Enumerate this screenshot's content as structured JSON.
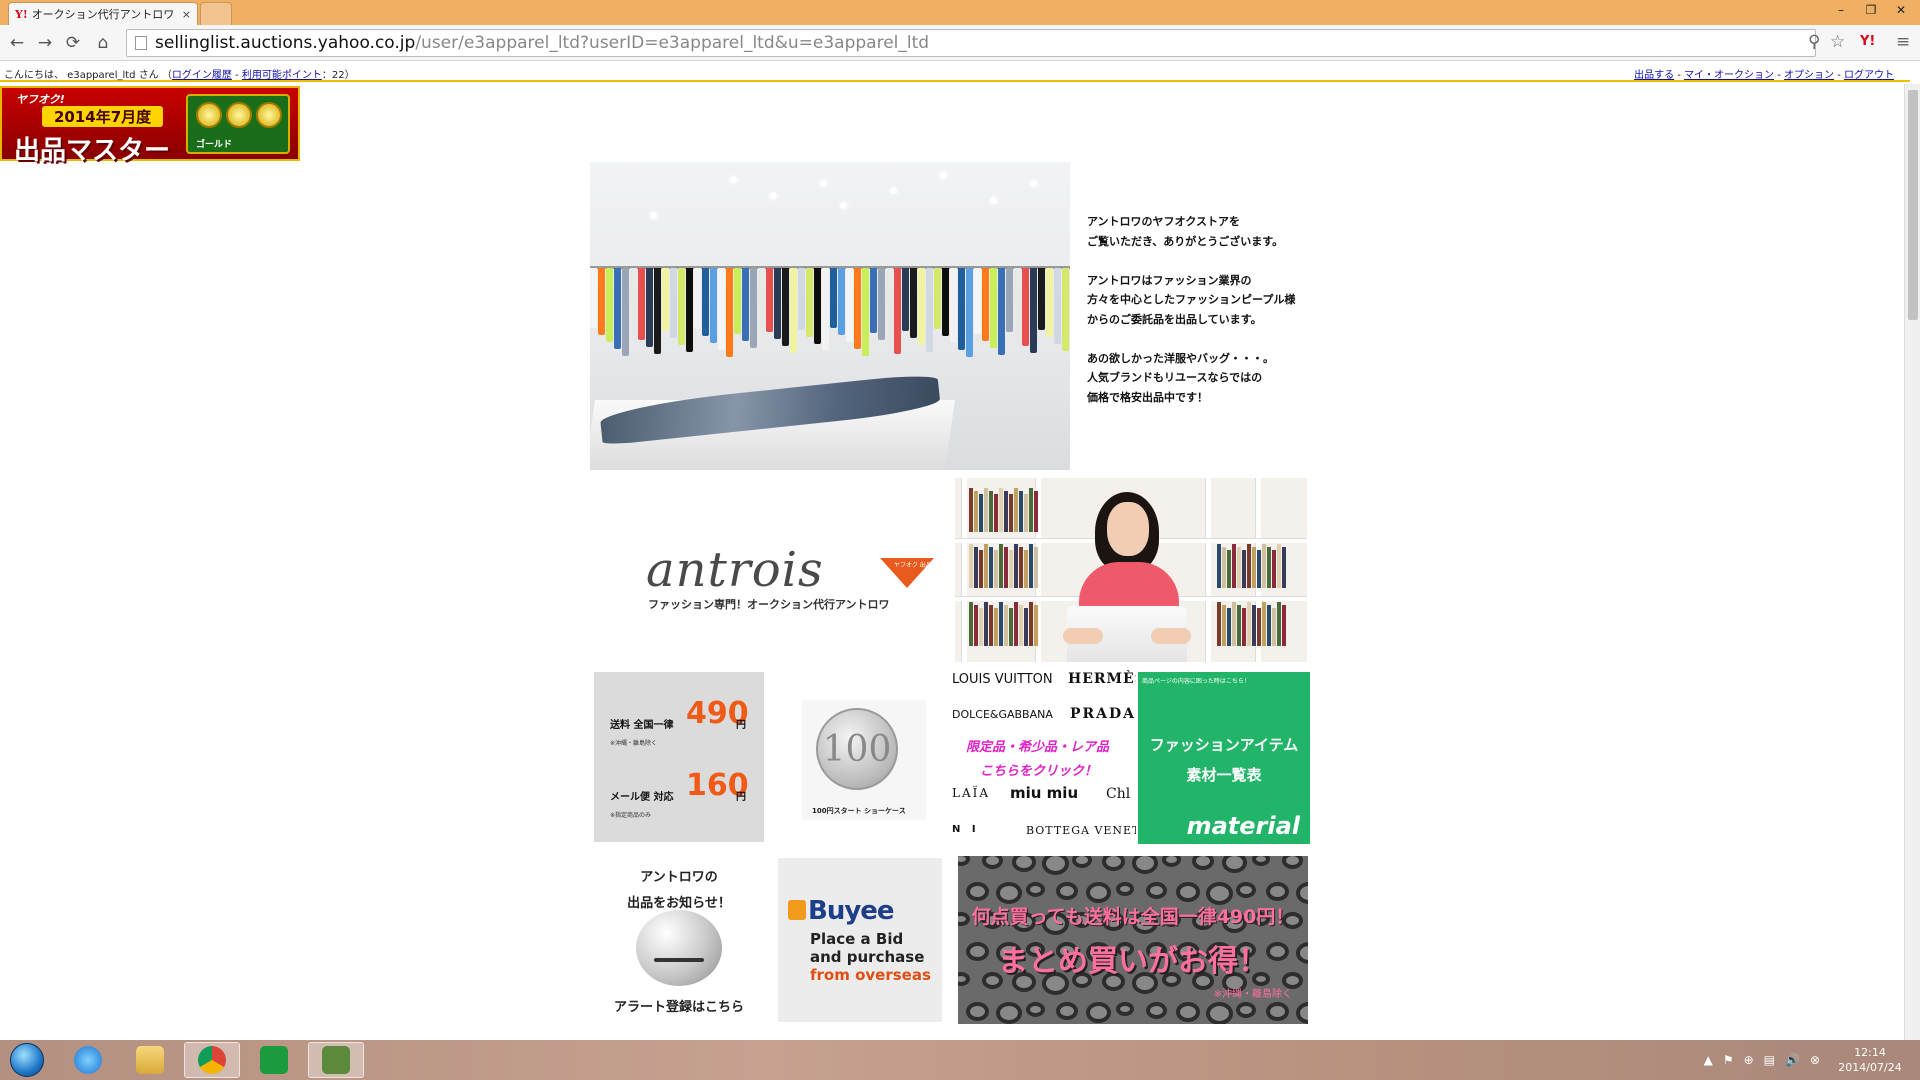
{
  "browser": {
    "tab_logo": "Y!",
    "tab_title": "オークション代行アントロワ (e",
    "tab_close": "×",
    "url_host": "sellinglist.auctions.yahoo.co.jp",
    "url_path": "/user/e3apparel_ltd?userID=e3apparel_ltd&u=e3apparel_ltd",
    "window_buttons": [
      "–",
      "❐",
      "✕"
    ],
    "nav": {
      "back": "←",
      "forward": "→",
      "reload": "⟳",
      "home": "⌂"
    },
    "omni_icons": [
      "⚲",
      "☆",
      "Y!",
      "≡"
    ]
  },
  "ybar": {
    "greeting": "こんにちは、 e3apparel_ltd さん （",
    "login_history": "ログイン履歴",
    "sep": " - ",
    "points_link": "利用可能ポイント",
    "points_value": "：22）",
    "right_links": [
      "出品する",
      "マイ・オークション",
      "オプション",
      "ログアウト"
    ],
    "right_sep": " - "
  },
  "badge": {
    "brand": "ヤフオク!",
    "year": "2014年7月度",
    "title": "出品マスター",
    "rank": "ゴールド"
  },
  "intro": {
    "p1": [
      "アントロワのヤフオクストアを",
      "ご覧いただき、ありがとうございます。"
    ],
    "p2": [
      "アントロワはファッション業界の",
      "方々を中心としたファッションピープル様",
      "からのご委託品を出品しています。"
    ],
    "p3": [
      "あの欲しかった洋服やバッグ・・・。",
      "人気ブランドもリユースならではの",
      "価格で格安出品中です！"
    ]
  },
  "logo": {
    "word": "antrois",
    "tag": "ヤフオク 出品ストア",
    "subtitle": "ファッション専門！オークション代行アントロワ"
  },
  "shipping": {
    "line1": "送料 全国一律",
    "price1": "490",
    "yen": "円",
    "note1": "※沖縄・離島除く",
    "line2": "メール便  対応",
    "price2": "160",
    "note2": "※指定商品のみ"
  },
  "showcase": {
    "coin_value": "100",
    "caption": "100円スタート ショーケース"
  },
  "brands": {
    "names": [
      "LOUIS VUITTON",
      "HERMÈS",
      "DOLCE&GABBANA",
      "PRADA",
      "LAÏA",
      "miu miu",
      "Chl",
      "N I",
      "BOTTEGA VENET"
    ],
    "pink1": "限定品・希少品・レア品",
    "pink2": "こちらをクリック！"
  },
  "material": {
    "top": "商品ページの内容に困った時はこちら！",
    "line1": "ファッションアイテム",
    "line2": "素材一覧表",
    "word": "material"
  },
  "alert": {
    "line1": "アントロワの",
    "line2": "出品をお知らせ！",
    "line3": "アラート登録はこちら"
  },
  "buyee": {
    "logo": "Buyee",
    "line1": "Place a Bid",
    "line2": "and purchase",
    "line3": "from overseas"
  },
  "leopard": {
    "line1": "何点買っても送料は全国一律490円！",
    "line2": "まとめ買いがお得！",
    "note": "※沖縄・離島除く"
  },
  "taskbar": {
    "tray_icons": [
      "▲",
      "⚑",
      "⊕",
      "▤",
      "🔊",
      "⊗"
    ],
    "time": "12:14",
    "date": "2014/07/24"
  }
}
